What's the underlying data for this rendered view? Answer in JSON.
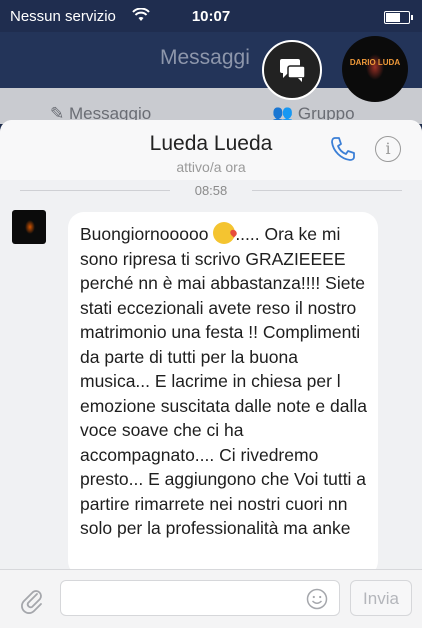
{
  "status_bar": {
    "carrier": "Nessun servizio",
    "time": "10:07"
  },
  "nav": {
    "title": "Messaggi",
    "segment_left": "Messaggio",
    "segment_right": "Gruppo"
  },
  "avatar_logo_text": "DARIO LUDA",
  "chat": {
    "contact_name": "Lueda Lueda",
    "presence": "attivo/a ora",
    "timestamp": "08:58",
    "message_before_emoji": "Buongiornooooo ",
    "message_after_emoji": "..... Ora ke mi sono ripresa ti scrivo GRAZIEEEE perché nn è mai abbastanza!!!! Siete stati eccezionali avete reso il nostro matrimonio una festa !! Complimenti da parte di tutti per la buona musica... E lacrime in chiesa per l emozione suscitata dalle note e dalla voce soave che ci ha accompagnato.... Ci rivedremo presto... E aggiungono che Voi tutti a partire rimarrete nei nostri cuori nn solo per la professionalità ma anke"
  },
  "composer": {
    "send_label": "Invia",
    "input_value": ""
  },
  "colors": {
    "nav_bg": "#233459",
    "accent_blue": "#3b7fd6",
    "bubble_bg": "#ffffff"
  },
  "icons": [
    "wifi-icon",
    "battery-icon",
    "compose-icon",
    "phone-icon",
    "info-icon",
    "paperclip-icon",
    "emoji-icon",
    "kiss-emoji-icon"
  ]
}
